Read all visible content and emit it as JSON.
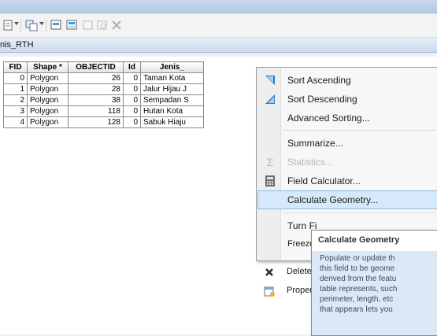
{
  "tab": {
    "label": "nis_RTH"
  },
  "toolbar": {
    "icons": [
      "table-options-icon",
      "related-tables-icon",
      "select-by-attributes-icon",
      "switch-selection-icon",
      "clear-selection-icon",
      "zoom-to-selected-icon",
      "delete-selected-icon"
    ]
  },
  "table": {
    "columns": [
      "FID",
      "Shape *",
      "OBJECTID",
      "Id",
      "Jenis_"
    ],
    "rows": [
      {
        "fid": "0",
        "shape": "Polygon",
        "objectid": "26",
        "id": "0",
        "jenis": "Taman Kota"
      },
      {
        "fid": "1",
        "shape": "Polygon",
        "objectid": "28",
        "id": "0",
        "jenis": "Jalur Hijau J"
      },
      {
        "fid": "2",
        "shape": "Polygon",
        "objectid": "38",
        "id": "0",
        "jenis": "Sempadan S"
      },
      {
        "fid": "3",
        "shape": "Polygon",
        "objectid": "118",
        "id": "0",
        "jenis": "Hutan Kota"
      },
      {
        "fid": "4",
        "shape": "Polygon",
        "objectid": "128",
        "id": "0",
        "jenis": "Sabuk Hiaju"
      }
    ]
  },
  "context_menu": {
    "items": [
      {
        "label": "Sort Ascending",
        "icon": "sort-ascending-icon"
      },
      {
        "label": "Sort Descending",
        "icon": "sort-descending-icon"
      },
      {
        "label": "Advanced Sorting..."
      },
      {
        "label": "Summarize..."
      },
      {
        "label": "Statistics...",
        "icon": "statistics-icon",
        "disabled": true
      },
      {
        "label": "Field Calculator...",
        "icon": "calculator-icon"
      },
      {
        "label": "Calculate Geometry...",
        "highlighted": true
      },
      {
        "label": "Turn Fi"
      },
      {
        "label": "Freeze"
      },
      {
        "label": "Delete",
        "icon": "delete-icon"
      },
      {
        "label": "Proper",
        "icon": "properties-icon"
      }
    ]
  },
  "tooltip": {
    "title": "Calculate Geometry",
    "lines": [
      "Populate or update th",
      "this field to be geome",
      "derived from the featu",
      "table represents, such",
      "perimeter, length, etc",
      "that appears lets you"
    ]
  },
  "colors": {
    "highlight": "#d6e8fb",
    "tooltip_body": "#dbe8f6",
    "titlebar": "#b4c9e4"
  }
}
